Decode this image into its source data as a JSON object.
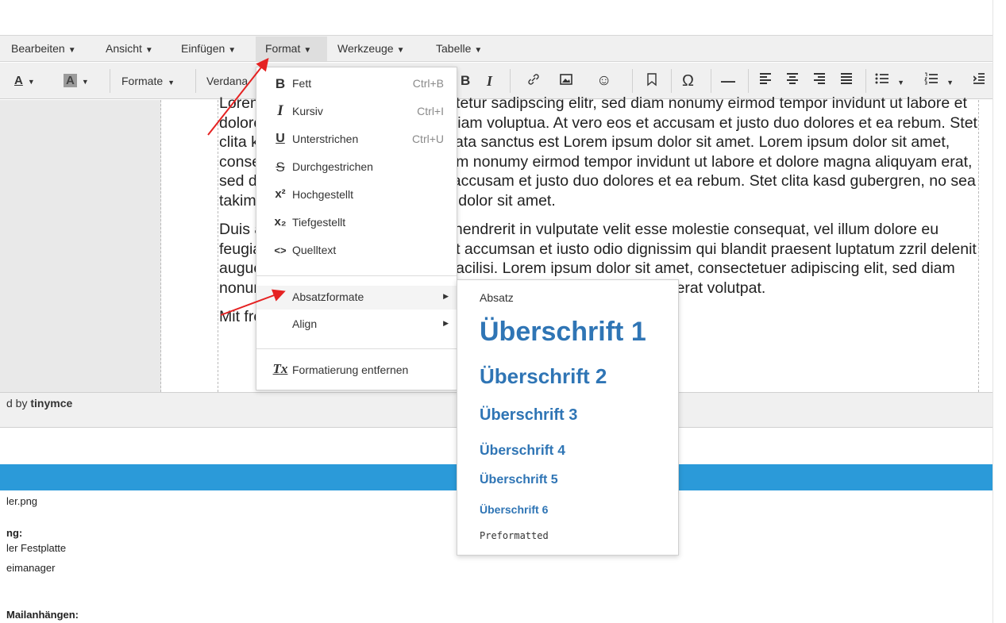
{
  "menubar": {
    "items": [
      "Bearbeiten",
      "Ansicht",
      "Einfügen",
      "Format",
      "Werkzeuge",
      "Tabelle"
    ],
    "active": "Format"
  },
  "toolbar": {
    "text_color_glyph": "A",
    "bg_color_glyph": "A",
    "formats_label": "Formate",
    "font_label": "Verdana",
    "bold_glyph": "B",
    "italic_glyph": "I",
    "icons": [
      "link-icon",
      "image-icon",
      "emoticon-icon",
      "bookmark-icon",
      "omega-icon",
      "horizontal-rule-icon",
      "align-left-icon",
      "align-center-icon",
      "align-right-icon",
      "align-justify-icon",
      "bullet-list-icon",
      "numbered-list-icon",
      "indent-icon"
    ],
    "omega": "Ω",
    "hr": "—",
    "smiley": "☺"
  },
  "editor": {
    "paragraph1": "Lorem ipsum dolor sit amet, consetetur sadipscing elitr, sed diam nonumy eirmod tempor invidunt ut labore et dolore magna aliquyam erat, sed diam voluptua. At vero eos et accusam et justo duo dolores et ea rebum. Stet clita kasd gubergren, no sea takimata sanctus est Lorem ipsum dolor sit amet. Lorem ipsum dolor sit amet, consetetur sadipscing elitr, sed diam nonumy eirmod tempor invidunt ut labore et dolore magna aliquyam erat, sed diam voluptua. At vero eos et accusam et justo duo dolores et ea rebum. Stet clita kasd gubergren, no sea takimata sanctus est Lorem ipsum dolor sit amet.",
    "paragraph2": "Duis autem vel eum iriure dolor in hendrerit in vulputate velit esse molestie consequat, vel illum dolore eu feugiat nulla facilisis at vero eros et accumsan et iusto odio dignissim qui blandit praesent luptatum zzril delenit augue duis dolore te feugait nulla facilisi. Lorem ipsum dolor sit amet, consectetuer adipiscing elit, sed diam nonummy nibh euismod tincidunt ut laoreet dolore magna aliquam erat volutpat.",
    "paragraph3": "Mit freundlichen Grüßen"
  },
  "statusbar": {
    "powered_prefix": "d by ",
    "powered_brand": "tinymce"
  },
  "lower": {
    "file_line": "ler.png",
    "heading_line": "ng:",
    "option1": "ler Festplatte",
    "option2": "eimanager",
    "mail_line": "Mailanhängen:"
  },
  "format_menu": {
    "items": [
      {
        "icon": "B",
        "label": "Fett",
        "shortcut": "Ctrl+B"
      },
      {
        "icon": "I",
        "label": "Kursiv",
        "shortcut": "Ctrl+I"
      },
      {
        "icon": "U",
        "label": "Unterstrichen",
        "shortcut": "Ctrl+U"
      },
      {
        "icon": "S",
        "label": "Durchgestrichen",
        "shortcut": ""
      },
      {
        "icon": "x²",
        "label": "Hochgestellt",
        "shortcut": ""
      },
      {
        "icon": "x₂",
        "label": "Tiefgestellt",
        "shortcut": ""
      },
      {
        "icon": "<>",
        "label": "Quelltext",
        "shortcut": ""
      }
    ],
    "submenus": [
      "Absatzformate",
      "Align"
    ],
    "clear": {
      "icon": "Tx",
      "label": "Formatierung entfernen"
    }
  },
  "paragraph_formats": {
    "items": [
      "Absatz",
      "Überschrift 1",
      "Überschrift 2",
      "Überschrift 3",
      "Überschrift 4",
      "Überschrift 5",
      "Überschrift 6",
      "Preformatted"
    ],
    "heading_color": "#2f75b5"
  },
  "annotation_color": "#e52222"
}
